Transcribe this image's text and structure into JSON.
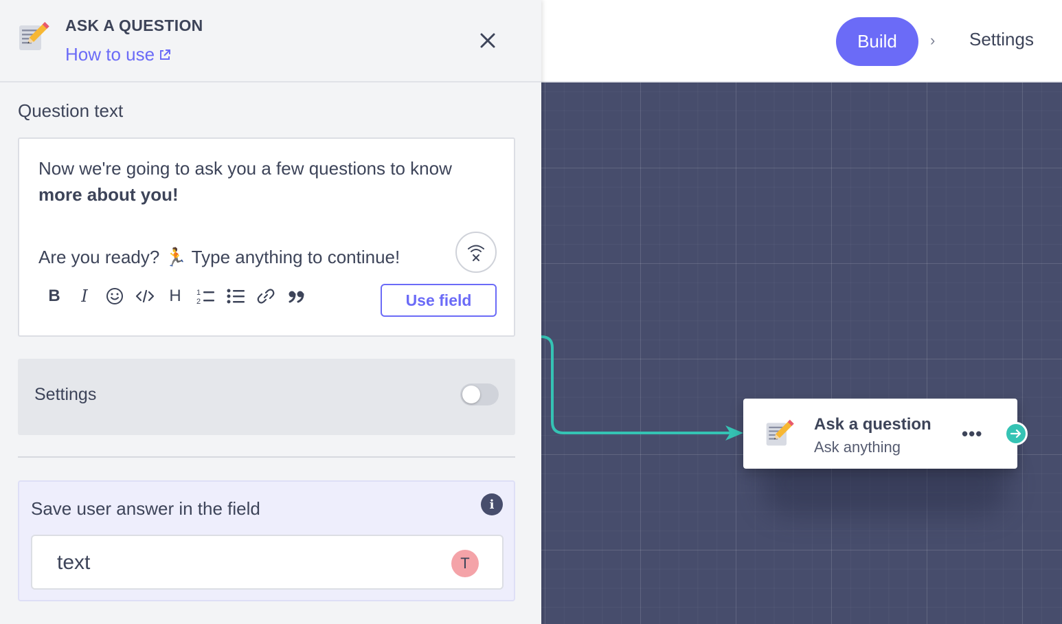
{
  "topbar": {
    "build_label": "Build",
    "separator": "›",
    "settings_label": "Settings"
  },
  "panel": {
    "title": "ASK A QUESTION",
    "how_to_use": "How to use",
    "question_label": "Question text",
    "question_text_line1": "Now we're going to ask you a few questions to know ",
    "question_text_bold": "more about you!",
    "question_text_line3": "Are you ready? 🏃 Type anything to continue!",
    "use_field_label": "Use field",
    "settings_label": "Settings",
    "settings_enabled": false,
    "save_label": "Save user answer in the field",
    "field_value": "text",
    "field_badge": "T"
  },
  "toolbar": {
    "bold": "B",
    "italic": "I",
    "heading": "H"
  },
  "node": {
    "title": "Ask a question",
    "subtitle": "Ask anything",
    "menu": "•••"
  },
  "colors": {
    "accent": "#6b6bf7",
    "canvas": "#474d6c",
    "connector": "#35c3b4",
    "badge": "#f4a3a8"
  }
}
